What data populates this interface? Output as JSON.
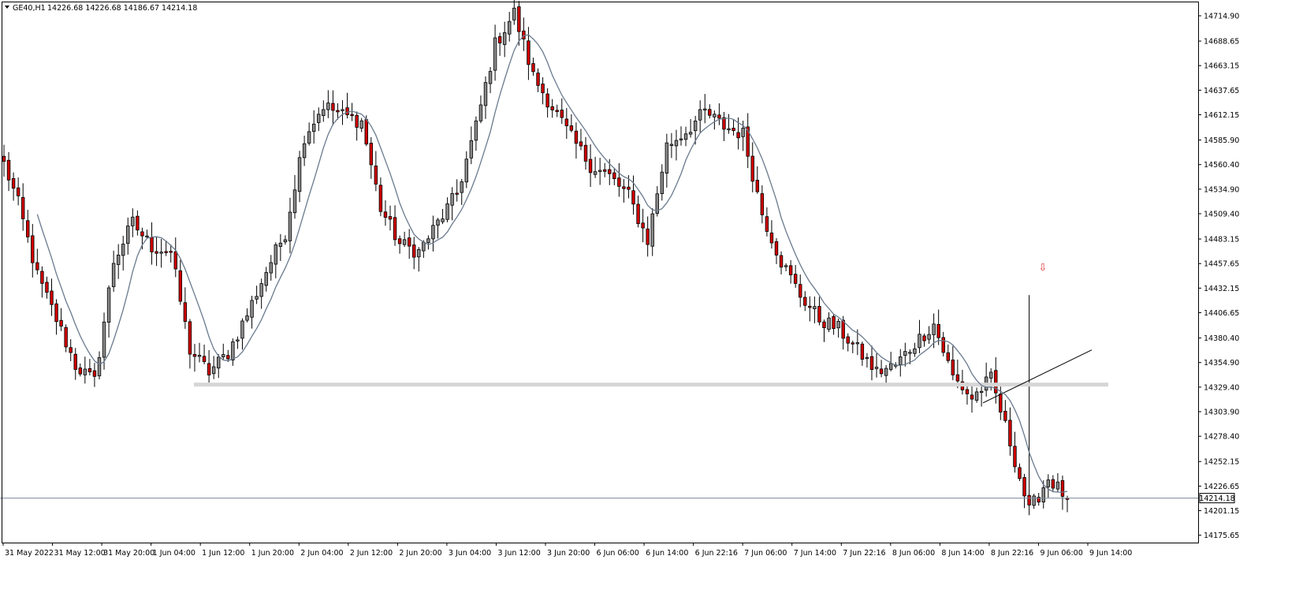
{
  "window": {
    "symbol_label": "GE40,H1",
    "ohlc_label": "14226.68 14226.68 14186.67 14214.18",
    "current_price_label": "14214.18"
  },
  "colors": {
    "bull_candle": "#8a8a8a",
    "bear_candle": "#d10000",
    "moving_average": "#6a7a8e",
    "support_band": "#d6d6d6",
    "price_line": "#7a8a9a",
    "sell_arrow": "#e03030"
  },
  "chart_data": {
    "type": "candlestick",
    "timeframe": "H1",
    "ylim": [
      14168,
      14728
    ],
    "y_ticks": [
      14714.9,
      14688.65,
      14663.15,
      14637.65,
      14612.15,
      14585.9,
      14560.4,
      14534.9,
      14509.4,
      14483.15,
      14457.65,
      14432.15,
      14406.65,
      14380.4,
      14354.9,
      14329.4,
      14303.9,
      14278.4,
      14252.15,
      14226.65,
      14201.15,
      14175.65
    ],
    "y_tick_labels": [
      "14714.90",
      "14688.65",
      "14663.15",
      "14637.65",
      "14612.15",
      "14585.90",
      "14560.40",
      "14534.90",
      "14509.40",
      "14483.15",
      "14457.65",
      "14432.15",
      "14406.65",
      "14380.40",
      "14354.90",
      "14329.40",
      "14303.90",
      "14278.40",
      "14252.15",
      "14226.65",
      "14201.15",
      "14175.65"
    ],
    "x_tick_labels": [
      "31 May 2022",
      "31 May 12:00",
      "31 May 20:00",
      "1 Jun 04:00",
      "1 Jun 12:00",
      "1 Jun 20:00",
      "2 Jun 04:00",
      "2 Jun 12:00",
      "2 Jun 20:00",
      "3 Jun 04:00",
      "3 Jun 12:00",
      "3 Jun 20:00",
      "6 Jun 06:00",
      "6 Jun 14:00",
      "6 Jun 22:16",
      "7 Jun 06:00",
      "7 Jun 14:00",
      "7 Jun 22:16",
      "8 Jun 06:00",
      "8 Jun 14:00",
      "8 Jun 22:16",
      "9 Jun 06:00",
      "9 Jun 14:00"
    ],
    "key_prices": [
      14575,
      14520,
      14445,
      14400,
      14352,
      14335,
      14460,
      14500,
      14475,
      14470,
      14368,
      14345,
      14365,
      14405,
      14450,
      14490,
      14590,
      14622,
      14612,
      14605,
      14515,
      14478,
      14470,
      14500,
      14530,
      14600,
      14685,
      14718,
      14652,
      14620,
      14588,
      14560,
      14548,
      14528,
      14482,
      14580,
      14595,
      14615,
      14600,
      14592,
      14510,
      14460,
      14425,
      14400,
      14390,
      14368,
      14345,
      14352,
      14375,
      14395,
      14340,
      14318,
      14338,
      14272,
      14200,
      14235,
      14214
    ],
    "ma_period": 8,
    "support_level": 14332,
    "current_price": 14214.18,
    "trendline": [
      [
        14313,
        14330
      ],
      [
        14365,
        14368
      ]
    ],
    "sell_signal_price": 14445
  }
}
